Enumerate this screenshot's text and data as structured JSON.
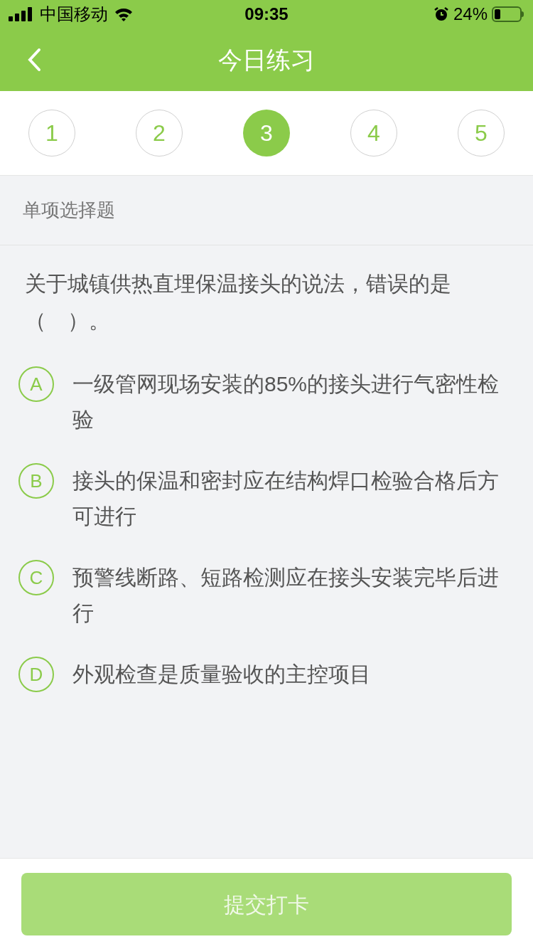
{
  "status_bar": {
    "carrier": "中国移动",
    "time": "09:35",
    "battery": "24%"
  },
  "nav": {
    "title": "今日练习"
  },
  "steps": [
    {
      "label": "1",
      "selected": false
    },
    {
      "label": "2",
      "selected": false
    },
    {
      "label": "3",
      "selected": true
    },
    {
      "label": "4",
      "selected": false
    },
    {
      "label": "5",
      "selected": false
    }
  ],
  "section": "单项选择题",
  "question": "关于城镇供热直埋保温接头的说法，错误的是（　）。",
  "options": [
    {
      "letter": "A",
      "text": "一级管网现场安装的85%的接头进行气密性检验",
      "selected": false
    },
    {
      "letter": "B",
      "text": "接头的保温和密封应在结构焊口检验合格后方可进行",
      "selected": false
    },
    {
      "letter": "C",
      "text": "预警线断路、短路检测应在接头安装完毕后进行",
      "selected": false
    },
    {
      "letter": "D",
      "text": "外观检查是质量验收的主控项目",
      "selected": false
    }
  ],
  "submit": {
    "label": "提交打卡",
    "disabled": true
  }
}
